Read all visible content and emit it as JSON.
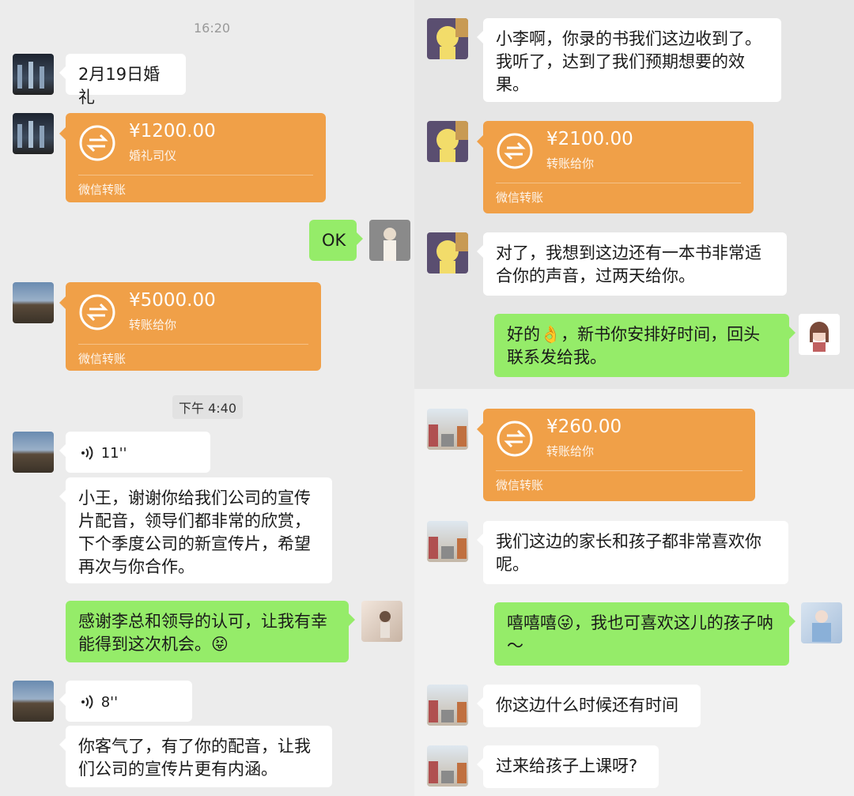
{
  "colors": {
    "background": "#ededed",
    "bubble_in": "#ffffff",
    "bubble_out": "#95ec69",
    "transfer": "#f0a048"
  },
  "left_top": {
    "timestamp": "16:20",
    "msg_date": "2月19日婚礼",
    "transfer": {
      "amount": "¥1200.00",
      "note": "婚礼司仪",
      "footer": "微信转账"
    },
    "reply_ok": "OK"
  },
  "left_bottom": {
    "transfer": {
      "amount": "¥5000.00",
      "note": "转账给你",
      "footer": "微信转账"
    },
    "time_label": "下午 4:40",
    "voice1": "11''",
    "msg1": "小王，谢谢你给我们公司的宣传片配音，领导们都非常的欣赏，下个季度公司的新宣传片，希望再次与你合作。",
    "reply": "感谢李总和领导的认可，让我有幸能得到这次机会。😝",
    "voice2": "8''",
    "msg2": "你客气了，有了你的配音，让我们公司的宣传片更有内涵。"
  },
  "right_top": {
    "msg1": "小李啊，你录的书我们这边收到了。我听了，达到了我们预期想要的效果。",
    "transfer": {
      "amount": "¥2100.00",
      "note": "转账给你",
      "footer": "微信转账"
    },
    "msg2": "对了，我想到这边还有一本书非常适合你的声音，过两天给你。",
    "reply": "好的👌，新书你安排好时间，回头联系发给我。"
  },
  "right_bottom": {
    "transfer": {
      "amount": "¥260.00",
      "note": "转账给你",
      "footer": "微信转账"
    },
    "msg1": "我们这边的家长和孩子都非常喜欢你呢。",
    "reply": "嘻嘻嘻😜，我也可喜欢这儿的孩子呐～",
    "msg2": "你这边什么时候还有时间",
    "msg3": "过来给孩子上课呀?"
  }
}
